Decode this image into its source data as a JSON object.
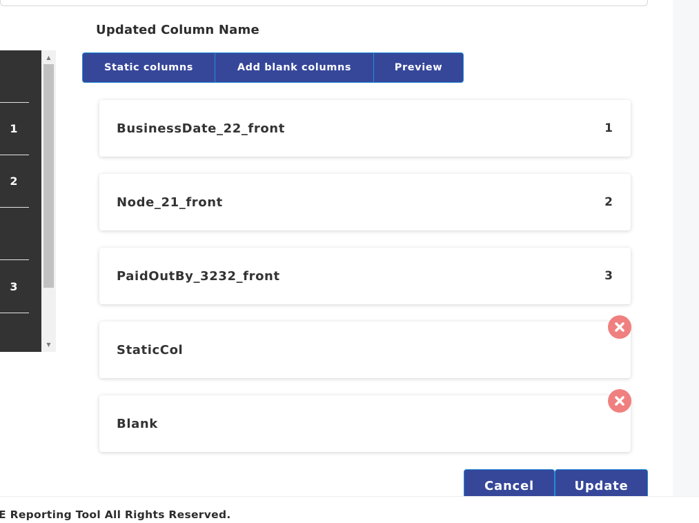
{
  "heading": "Updated Column Name",
  "left_panel": {
    "rows": [
      "",
      "1",
      "2",
      "",
      "3"
    ]
  },
  "tabs": [
    "Static columns",
    "Add blank columns",
    "Preview"
  ],
  "columns": [
    {
      "label": "BusinessDate_22_front",
      "number": "1"
    },
    {
      "label": "Node_21_front",
      "number": "2"
    },
    {
      "label": "PaidOutBy_3232_front",
      "number": "3"
    },
    {
      "label": "StaticCol",
      "number": ""
    },
    {
      "label": "Blank",
      "number": ""
    }
  ],
  "remove_icon_color": "#f08080",
  "accent_color": "#36479a",
  "buttons": {
    "cancel": "Cancel",
    "update": "Update"
  },
  "footer": {
    "text": "E Reporting Tool All Rights Reserved."
  }
}
